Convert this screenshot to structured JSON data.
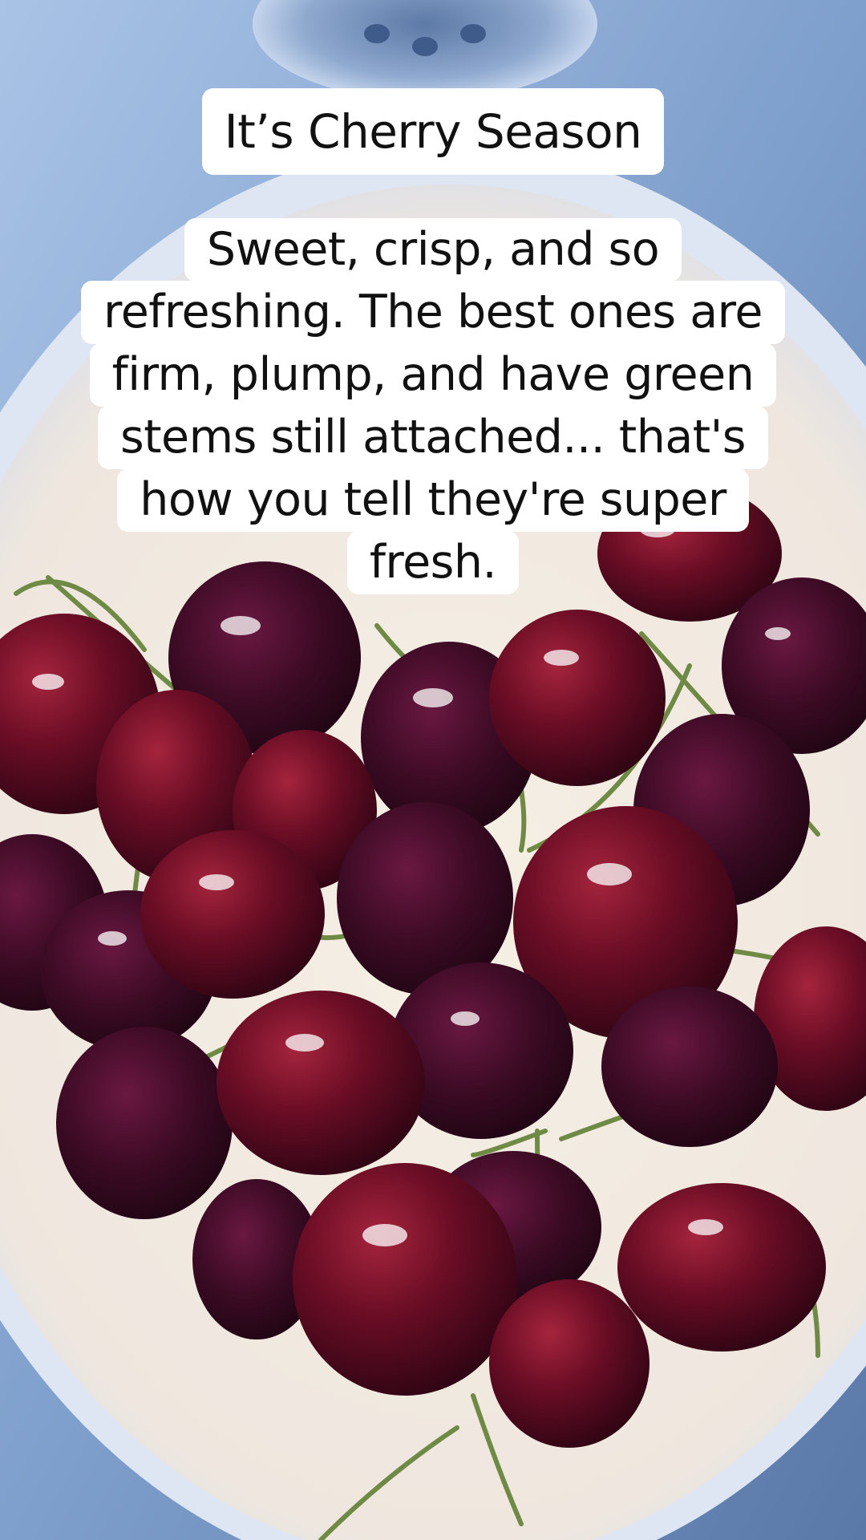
{
  "photo": {
    "subject": "cherries-in-white-bowl-in-sink",
    "colors": {
      "sink": "#7b9ac4",
      "bowl": "#f3eee8",
      "cherry": "#5a0a1e",
      "stem": "#6f8a45"
    }
  },
  "caption": {
    "title": "It’s Cherry Season",
    "body_lines": [
      "Sweet, crisp, and so",
      "refreshing. The best ones are",
      "firm, plump, and have green",
      "stems still attached... that's",
      "how you tell they're super",
      "fresh."
    ]
  }
}
